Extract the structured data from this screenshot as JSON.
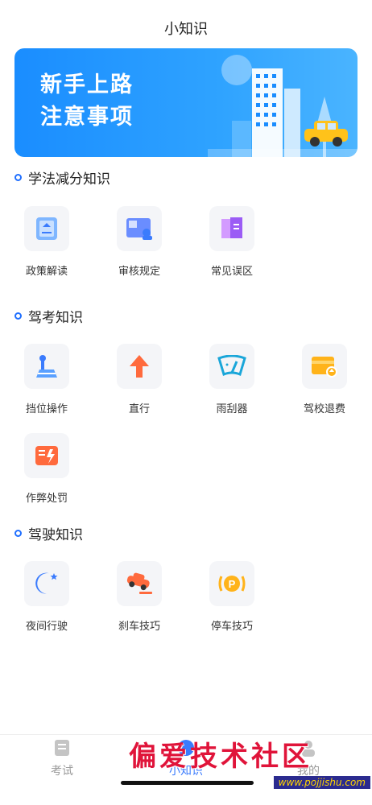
{
  "header": {
    "title": "小知识"
  },
  "banner": {
    "line1": "新手上路",
    "line2": "注意事项"
  },
  "sections": [
    {
      "title": "学法减分知识",
      "items": [
        {
          "label": "政策解读",
          "icon": "policy-book-icon"
        },
        {
          "label": "审核规定",
          "icon": "review-id-card-icon"
        },
        {
          "label": "常见误区",
          "icon": "mistake-flag-icon"
        }
      ]
    },
    {
      "title": "驾考知识",
      "items": [
        {
          "label": "挡位操作",
          "icon": "gear-shift-icon"
        },
        {
          "label": "直行",
          "icon": "arrow-up-icon"
        },
        {
          "label": "雨刮器",
          "icon": "wiper-icon"
        },
        {
          "label": "驾校退费",
          "icon": "refund-wallet-icon"
        },
        {
          "label": "作弊处罚",
          "icon": "penalty-card-icon"
        }
      ]
    },
    {
      "title": "驾驶知识",
      "items": [
        {
          "label": "夜间行驶",
          "icon": "moon-icon"
        },
        {
          "label": "刹车技巧",
          "icon": "brake-car-icon"
        },
        {
          "label": "停车技巧",
          "icon": "parking-icon"
        }
      ]
    }
  ],
  "tabbar": {
    "tabs": [
      {
        "label": "考试",
        "icon": "exam-icon"
      },
      {
        "label": "小知识",
        "icon": "knowledge-icon"
      },
      {
        "label": "我的",
        "icon": "profile-icon"
      }
    ]
  },
  "watermark": {
    "text": "偏爱技术社区",
    "url": "www.pojjishu.com"
  }
}
